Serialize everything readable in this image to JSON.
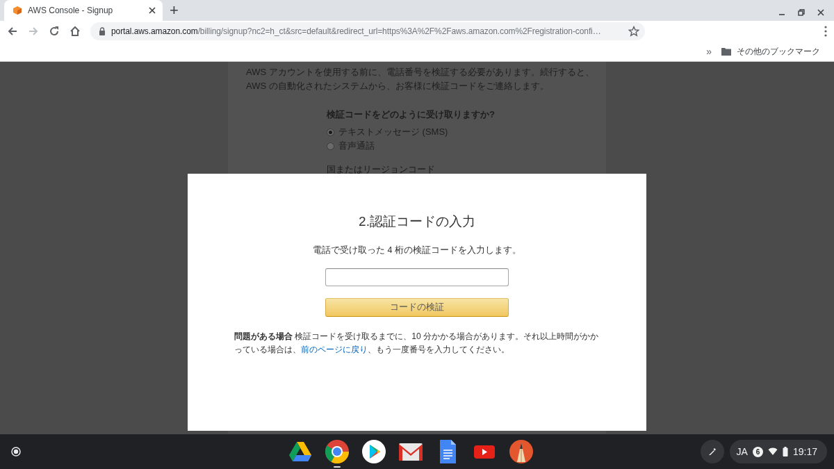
{
  "browser": {
    "tab": {
      "title": "AWS Console - Signup",
      "selected": true
    },
    "new_tab": "+",
    "address": {
      "host": "portal.aws.amazon.com",
      "path": "/billing/signup?nc2=h_ct&src=default&redirect_url=https%3A%2F%2Faws.amazon.com%2Fregistration-confi…"
    },
    "bookmarks": {
      "overflow": "»",
      "other": "その他のブックマーク"
    }
  },
  "background_page": {
    "intro_lines": [
      "AWS アカウントを使用する前に、電話番号を検証する必要があります。続行すると、",
      "AWS の自動化されたシステムから、お客様に検証コードをご連絡します。"
    ],
    "question": "検証コードをどのように受け取りますか?",
    "options": [
      {
        "label": "テキストメッセージ (SMS)",
        "selected": true
      },
      {
        "label": "音声通話",
        "selected": false
      }
    ],
    "region_label": "国またはリージョンコード"
  },
  "dialog": {
    "title": "2.認証コードの入力",
    "instruction": "電話で受け取った 4 桁の検証コードを入力します。",
    "button": "コードの検証",
    "help": {
      "before": "**問題がある場合** 検証コードを受け取るまでに、10 分かかる場合があります。それ以上時間がかかっている場合は、",
      "link": "前のページに戻り",
      "after": "、もう一度番号を入力してください。"
    }
  },
  "shelf": {
    "apps": [
      {
        "kind": "drive",
        "active": false
      },
      {
        "kind": "chrome",
        "active": true
      },
      {
        "kind": "play",
        "active": false
      },
      {
        "kind": "gmail",
        "active": false
      },
      {
        "kind": "docs",
        "active": false
      },
      {
        "kind": "youtube",
        "active": false
      },
      {
        "kind": "sketch",
        "active": false
      }
    ],
    "tray": {
      "language": "JA",
      "notifications": "6",
      "time": "19:17"
    }
  }
}
